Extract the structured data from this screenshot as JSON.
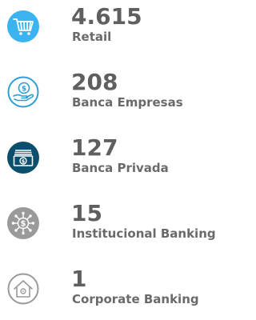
{
  "segments": [
    {
      "value": "4.615",
      "label": "Retail",
      "icon": "shopping-cart-icon",
      "icon_bg": "#3bb3f0"
    },
    {
      "value": "208",
      "label": "Banca Empresas",
      "icon": "hand-coin-icon",
      "icon_bg": "#2d9fd4"
    },
    {
      "value": "127",
      "label": "Banca Privada",
      "icon": "banknotes-icon",
      "icon_bg": "#0b4f6c"
    },
    {
      "value": "15",
      "label": "Institucional Banking",
      "icon": "dollar-network-icon",
      "icon_bg": "#9a9a9a"
    },
    {
      "value": "1",
      "label": "Corporate Banking",
      "icon": "building-icon",
      "icon_bg": "#9a9a9a"
    }
  ]
}
